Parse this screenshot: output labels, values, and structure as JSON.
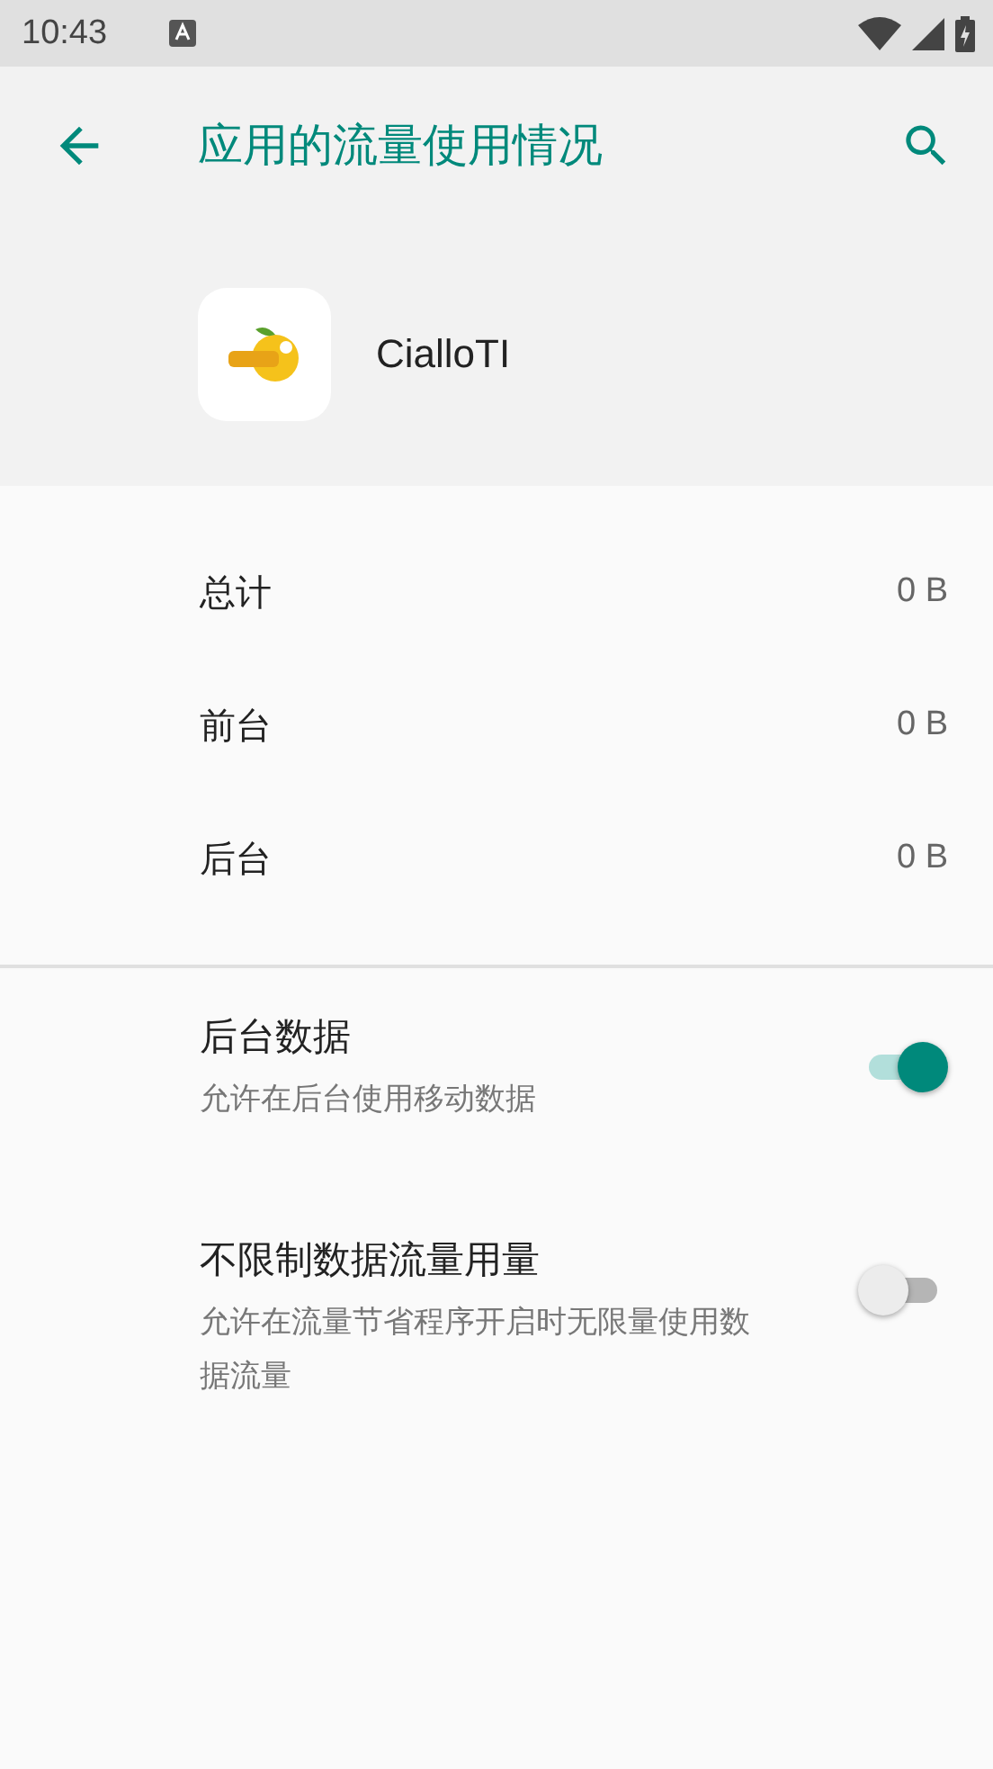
{
  "status_bar": {
    "time": "10:43"
  },
  "toolbar": {
    "title": "应用的流量使用情况"
  },
  "app": {
    "name": "CialloTI"
  },
  "usage": [
    {
      "label": "总计",
      "value": "0 B"
    },
    {
      "label": "前台",
      "value": "0 B"
    },
    {
      "label": "后台",
      "value": "0 B"
    }
  ],
  "settings": [
    {
      "title": "后台数据",
      "summary": "允许在后台使用移动数据",
      "on": true
    },
    {
      "title": "不限制数据流量用量",
      "summary": "允许在流量节省程序开启时无限量使用数据流量",
      "on": false
    }
  ]
}
